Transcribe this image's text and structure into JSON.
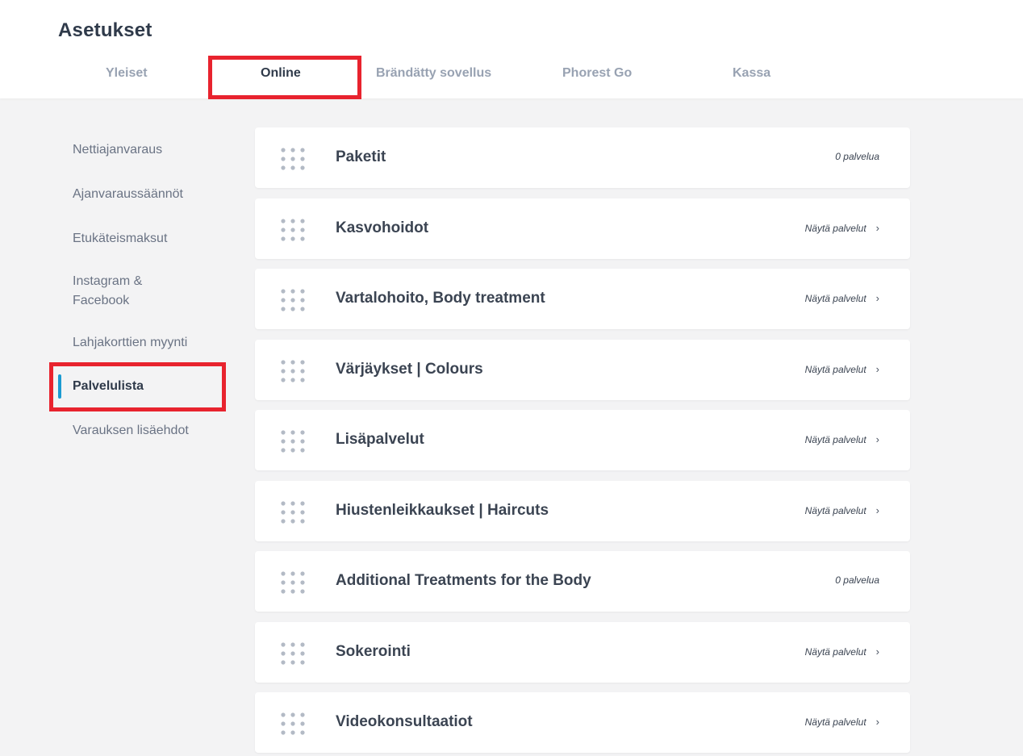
{
  "page": {
    "title": "Asetukset"
  },
  "tabs": [
    {
      "label": "Yleiset"
    },
    {
      "label": "Online"
    },
    {
      "label": "Brändätty sovellus"
    },
    {
      "label": "Phorest Go"
    },
    {
      "label": "Kassa"
    }
  ],
  "sidebar": {
    "items": [
      {
        "label": "Nettiajanvaraus"
      },
      {
        "label": "Ajanvaraussäännöt"
      },
      {
        "label": "Etukäteismaksut"
      },
      {
        "label": "Instagram &"
      },
      {
        "label": "Facebook"
      },
      {
        "label": "Lahjakorttien myynti"
      },
      {
        "label": "Palvelulista"
      },
      {
        "label": "Varauksen lisäehdot"
      }
    ]
  },
  "categories": [
    {
      "name": "Paketit",
      "action": "0 palvelua"
    },
    {
      "name": "Kasvohoidot",
      "action": "Näytä palvelut"
    },
    {
      "name": "Vartalohoito, Body treatment",
      "action": "Näytä palvelut"
    },
    {
      "name": "Värjäykset | Colours",
      "action": "Näytä palvelut"
    },
    {
      "name": "Lisäpalvelut",
      "action": "Näytä palvelut"
    },
    {
      "name": "Hiustenleikkaukset | Haircuts",
      "action": "Näytä palvelut"
    },
    {
      "name": "Additional Treatments for the Body",
      "action": "0 palvelua"
    },
    {
      "name": "Sokerointi",
      "action": "Näytä palvelut"
    },
    {
      "name": "Videokonsultaatiot",
      "action": "Näytä palvelut"
    }
  ],
  "icons": {
    "drag": "drag-handle-icon",
    "chevron": "chevron-right-icon"
  },
  "colors": {
    "accent": "#1b9bd1",
    "highlight": "#e8232e",
    "background": "#f3f3f4",
    "card": "#ffffff",
    "tab_inactive": "#98a2b2",
    "text_dark": "#2f3a4a"
  }
}
